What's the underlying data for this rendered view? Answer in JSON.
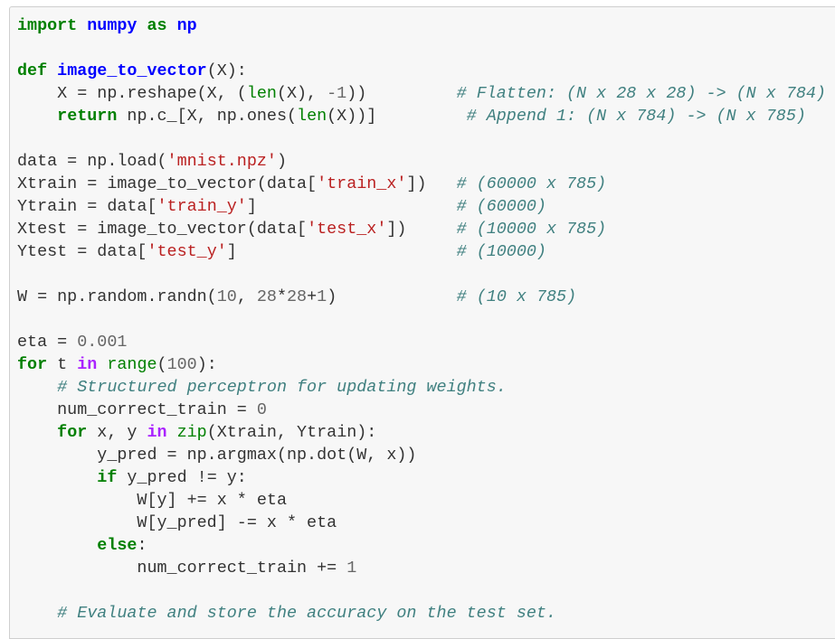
{
  "cell": {
    "language": "python",
    "lines": [
      [
        {
          "t": "kw",
          "v": "import"
        },
        {
          "t": "",
          "v": " "
        },
        {
          "t": "mod",
          "v": "numpy"
        },
        {
          "t": "",
          "v": " "
        },
        {
          "t": "kw",
          "v": "as"
        },
        {
          "t": "",
          "v": " "
        },
        {
          "t": "mod",
          "v": "np"
        }
      ],
      [],
      [
        {
          "t": "kw",
          "v": "def"
        },
        {
          "t": "",
          "v": " "
        },
        {
          "t": "mod",
          "v": "image_to_vector"
        },
        {
          "t": "",
          "v": "(X):"
        }
      ],
      [
        {
          "t": "",
          "v": "    X = np.reshape(X, ("
        },
        {
          "t": "bi",
          "v": "len"
        },
        {
          "t": "",
          "v": "(X), "
        },
        {
          "t": "num",
          "v": "-1"
        },
        {
          "t": "",
          "v": "))         "
        },
        {
          "t": "cm",
          "v": "# Flatten: (N x 28 x 28) -> (N x 784)"
        }
      ],
      [
        {
          "t": "",
          "v": "    "
        },
        {
          "t": "kw",
          "v": "return"
        },
        {
          "t": "",
          "v": " np.c_[X, np.ones("
        },
        {
          "t": "bi",
          "v": "len"
        },
        {
          "t": "",
          "v": "(X))]         "
        },
        {
          "t": "cm",
          "v": "# Append 1: (N x 784) -> (N x 785)"
        }
      ],
      [],
      [
        {
          "t": "",
          "v": "data = np.load("
        },
        {
          "t": "str",
          "v": "'mnist.npz'"
        },
        {
          "t": "",
          "v": ")"
        }
      ],
      [
        {
          "t": "",
          "v": "Xtrain = image_to_vector(data["
        },
        {
          "t": "str",
          "v": "'train_x'"
        },
        {
          "t": "",
          "v": "])   "
        },
        {
          "t": "cm",
          "v": "# (60000 x 785)"
        }
      ],
      [
        {
          "t": "",
          "v": "Ytrain = data["
        },
        {
          "t": "str",
          "v": "'train_y'"
        },
        {
          "t": "",
          "v": "]                    "
        },
        {
          "t": "cm",
          "v": "# (60000)"
        }
      ],
      [
        {
          "t": "",
          "v": "Xtest = image_to_vector(data["
        },
        {
          "t": "str",
          "v": "'test_x'"
        },
        {
          "t": "",
          "v": "])     "
        },
        {
          "t": "cm",
          "v": "# (10000 x 785)"
        }
      ],
      [
        {
          "t": "",
          "v": "Ytest = data["
        },
        {
          "t": "str",
          "v": "'test_y'"
        },
        {
          "t": "",
          "v": "]                      "
        },
        {
          "t": "cm",
          "v": "# (10000)"
        }
      ],
      [],
      [
        {
          "t": "",
          "v": "W = np.random.randn("
        },
        {
          "t": "num",
          "v": "10"
        },
        {
          "t": "",
          "v": ", "
        },
        {
          "t": "num",
          "v": "28"
        },
        {
          "t": "",
          "v": "*"
        },
        {
          "t": "num",
          "v": "28"
        },
        {
          "t": "",
          "v": "+"
        },
        {
          "t": "num",
          "v": "1"
        },
        {
          "t": "",
          "v": ")            "
        },
        {
          "t": "cm",
          "v": "# (10 x 785)"
        }
      ],
      [],
      [
        {
          "t": "",
          "v": "eta = "
        },
        {
          "t": "num",
          "v": "0.001"
        }
      ],
      [
        {
          "t": "kw",
          "v": "for"
        },
        {
          "t": "",
          "v": " t "
        },
        {
          "t": "op-kw",
          "v": "in"
        },
        {
          "t": "",
          "v": " "
        },
        {
          "t": "bi",
          "v": "range"
        },
        {
          "t": "",
          "v": "("
        },
        {
          "t": "num",
          "v": "100"
        },
        {
          "t": "",
          "v": "):"
        }
      ],
      [
        {
          "t": "",
          "v": "    "
        },
        {
          "t": "cm",
          "v": "# Structured perceptron for updating weights."
        }
      ],
      [
        {
          "t": "",
          "v": "    num_correct_train = "
        },
        {
          "t": "num",
          "v": "0"
        }
      ],
      [
        {
          "t": "",
          "v": "    "
        },
        {
          "t": "kw",
          "v": "for"
        },
        {
          "t": "",
          "v": " x, y "
        },
        {
          "t": "op-kw",
          "v": "in"
        },
        {
          "t": "",
          "v": " "
        },
        {
          "t": "bi",
          "v": "zip"
        },
        {
          "t": "",
          "v": "(Xtrain, Ytrain):"
        }
      ],
      [
        {
          "t": "",
          "v": "        y_pred = np.argmax(np.dot(W, x))"
        }
      ],
      [
        {
          "t": "",
          "v": "        "
        },
        {
          "t": "kw",
          "v": "if"
        },
        {
          "t": "",
          "v": " y_pred != y:"
        }
      ],
      [
        {
          "t": "",
          "v": "            W[y] += x * eta"
        }
      ],
      [
        {
          "t": "",
          "v": "            W[y_pred] -= x * eta"
        }
      ],
      [
        {
          "t": "",
          "v": "        "
        },
        {
          "t": "kw",
          "v": "else"
        },
        {
          "t": "",
          "v": ":"
        }
      ],
      [
        {
          "t": "",
          "v": "            num_correct_train += "
        },
        {
          "t": "num",
          "v": "1"
        }
      ],
      [],
      [
        {
          "t": "",
          "v": "    "
        },
        {
          "t": "cm",
          "v": "# Evaluate and store the accuracy on the test set."
        }
      ]
    ]
  },
  "colors": {
    "cell_background": "#f7f7f7",
    "cell_border": "#cfcfcf",
    "keyword": "#008000",
    "name": "#0000ff",
    "operator_keyword": "#aa22ff",
    "string": "#ba2121",
    "number": "#666666",
    "comment": "#408080",
    "text": "#333333"
  }
}
